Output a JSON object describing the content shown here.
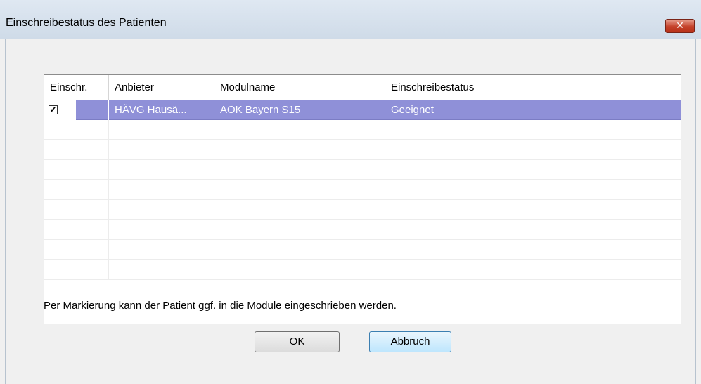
{
  "window": {
    "title": "Einschreibestatus des Patienten",
    "close_symbol": "✕"
  },
  "grid": {
    "columns": [
      "Einschr.",
      "Anbieter",
      "Modulname",
      "Einschreibestatus"
    ],
    "rows": [
      {
        "checked": true,
        "anbieter": "HÄVG Hausä...",
        "modulname": "AOK Bayern S15",
        "status": "Geeignet",
        "selected": true
      }
    ],
    "empty_rows": 8
  },
  "info_text": "Per Markierung kann der Patient ggf. in die Module eingeschrieben werden.",
  "buttons": {
    "ok": "OK",
    "cancel": "Abbruch"
  },
  "colors": {
    "selection": "#8f90d8",
    "close_button": "#c4412a"
  },
  "icons": {
    "close": "close-icon",
    "check": "checkbox-checked-icon"
  }
}
